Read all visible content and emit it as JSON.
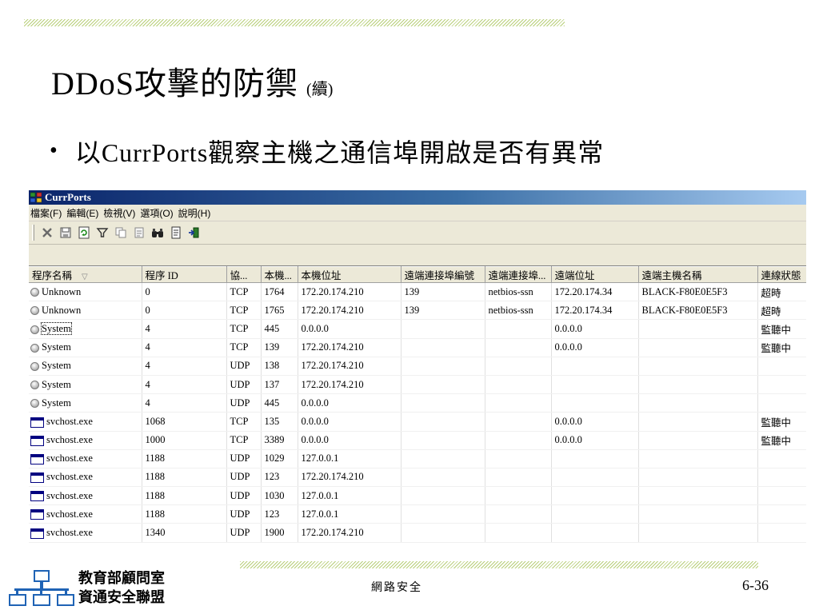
{
  "slide": {
    "title": "DDoS攻擊的防禦",
    "title_suffix": "(續)",
    "bullet": "以CurrPorts觀察主機之通信埠開啟是否有異常"
  },
  "window": {
    "title": "CurrPorts",
    "menu": [
      "檔案(F)",
      "編輯(E)",
      "檢視(V)",
      "選項(O)",
      "說明(H)"
    ],
    "toolbar_icons": [
      "close-icon",
      "save-icon",
      "refresh-icon",
      "filter-icon",
      "copy-icon",
      "properties-icon",
      "find-icon",
      "report-icon",
      "exit-icon"
    ],
    "columns": [
      "程序名稱",
      "程序 ID",
      "協...",
      "本機...",
      "本機位址",
      "遠端連接埠編號",
      "遠端連接埠...",
      "遠端位址",
      "遠端主機名稱",
      "連線狀態"
    ],
    "sort_indicator": "▽",
    "rows": [
      {
        "icon": "circle",
        "name": "Unknown",
        "pid": "0",
        "proto": "TCP",
        "lport": "1764",
        "laddr": "172.20.174.210",
        "rport": "139",
        "rportname": "netbios-ssn",
        "raddr": "172.20.174.34",
        "rhost": "BLACK-F80E0E5F3",
        "state": "超時"
      },
      {
        "icon": "circle",
        "name": "Unknown",
        "pid": "0",
        "proto": "TCP",
        "lport": "1765",
        "laddr": "172.20.174.210",
        "rport": "139",
        "rportname": "netbios-ssn",
        "raddr": "172.20.174.34",
        "rhost": "BLACK-F80E0E5F3",
        "state": "超時"
      },
      {
        "icon": "circle",
        "name": "System",
        "pid": "4",
        "proto": "TCP",
        "lport": "445",
        "laddr": "0.0.0.0",
        "rport": "",
        "rportname": "",
        "raddr": "0.0.0.0",
        "rhost": "",
        "state": "監聽中",
        "selected": true
      },
      {
        "icon": "circle",
        "name": "System",
        "pid": "4",
        "proto": "TCP",
        "lport": "139",
        "laddr": "172.20.174.210",
        "rport": "",
        "rportname": "",
        "raddr": "0.0.0.0",
        "rhost": "",
        "state": "監聽中"
      },
      {
        "icon": "circle",
        "name": "System",
        "pid": "4",
        "proto": "UDP",
        "lport": "138",
        "laddr": "172.20.174.210",
        "rport": "",
        "rportname": "",
        "raddr": "",
        "rhost": "",
        "state": ""
      },
      {
        "icon": "circle",
        "name": "System",
        "pid": "4",
        "proto": "UDP",
        "lport": "137",
        "laddr": "172.20.174.210",
        "rport": "",
        "rportname": "",
        "raddr": "",
        "rhost": "",
        "state": ""
      },
      {
        "icon": "circle",
        "name": "System",
        "pid": "4",
        "proto": "UDP",
        "lport": "445",
        "laddr": "0.0.0.0",
        "rport": "",
        "rportname": "",
        "raddr": "",
        "rhost": "",
        "state": ""
      },
      {
        "icon": "window",
        "name": "svchost.exe",
        "pid": "1068",
        "proto": "TCP",
        "lport": "135",
        "laddr": "0.0.0.0",
        "rport": "",
        "rportname": "",
        "raddr": "0.0.0.0",
        "rhost": "",
        "state": "監聽中"
      },
      {
        "icon": "window",
        "name": "svchost.exe",
        "pid": "1000",
        "proto": "TCP",
        "lport": "3389",
        "laddr": "0.0.0.0",
        "rport": "",
        "rportname": "",
        "raddr": "0.0.0.0",
        "rhost": "",
        "state": "監聽中"
      },
      {
        "icon": "window",
        "name": "svchost.exe",
        "pid": "1188",
        "proto": "UDP",
        "lport": "1029",
        "laddr": "127.0.0.1",
        "rport": "",
        "rportname": "",
        "raddr": "",
        "rhost": "",
        "state": ""
      },
      {
        "icon": "window",
        "name": "svchost.exe",
        "pid": "1188",
        "proto": "UDP",
        "lport": "123",
        "laddr": "172.20.174.210",
        "rport": "",
        "rportname": "",
        "raddr": "",
        "rhost": "",
        "state": ""
      },
      {
        "icon": "window",
        "name": "svchost.exe",
        "pid": "1188",
        "proto": "UDP",
        "lport": "1030",
        "laddr": "127.0.0.1",
        "rport": "",
        "rportname": "",
        "raddr": "",
        "rhost": "",
        "state": ""
      },
      {
        "icon": "window",
        "name": "svchost.exe",
        "pid": "1188",
        "proto": "UDP",
        "lport": "123",
        "laddr": "127.0.0.1",
        "rport": "",
        "rportname": "",
        "raddr": "",
        "rhost": "",
        "state": ""
      },
      {
        "icon": "window",
        "name": "svchost.exe",
        "pid": "1340",
        "proto": "UDP",
        "lport": "1900",
        "laddr": "172.20.174.210",
        "rport": "",
        "rportname": "",
        "raddr": "",
        "rhost": "",
        "state": ""
      }
    ]
  },
  "footer": {
    "logo_line1": "教育部顧問室",
    "logo_line2": "資通安全聯盟",
    "center": "網路安全",
    "page": "6-36"
  },
  "colors": {
    "titlebar_start": "#0a246a",
    "titlebar_end": "#a6caf0",
    "hatch": "#b9cf7a",
    "logo_blue": "#1f63b5"
  }
}
